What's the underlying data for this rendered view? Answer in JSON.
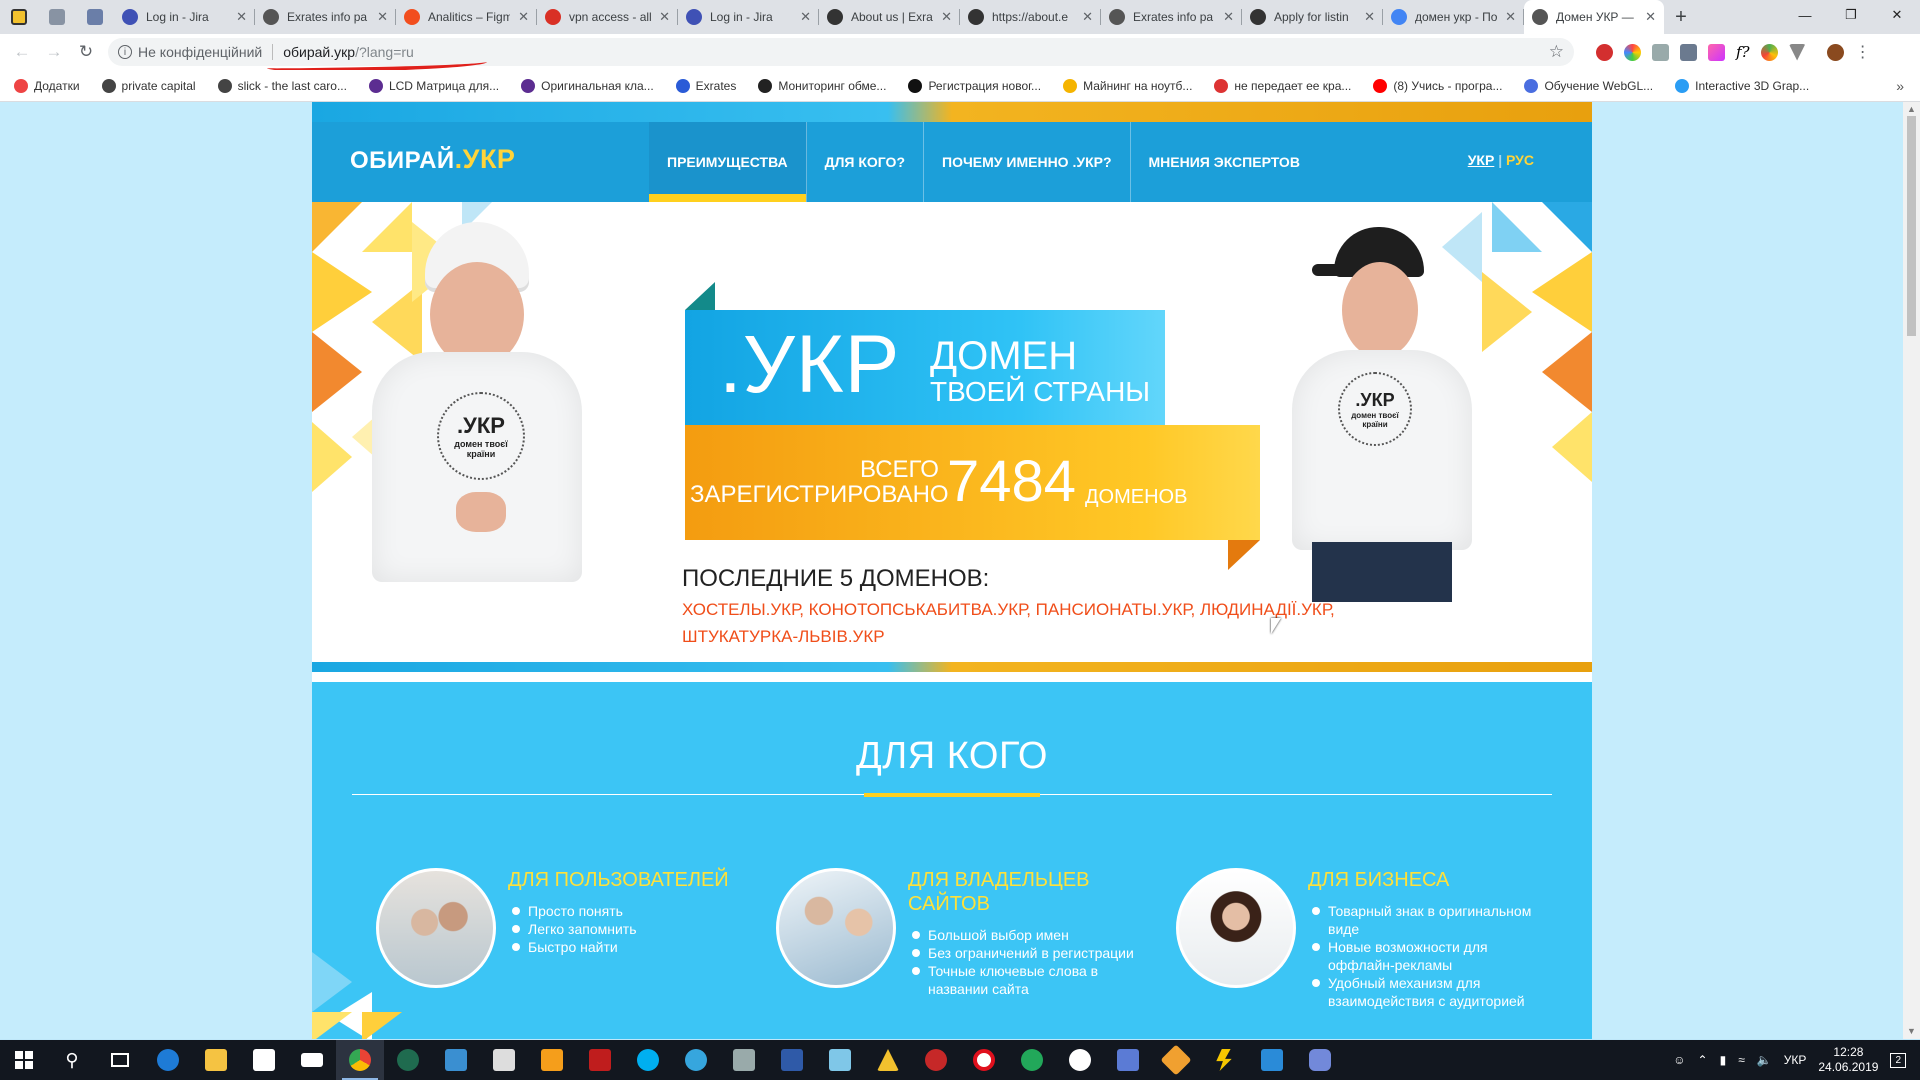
{
  "browser": {
    "tabs": [
      {
        "title": "Log in - Jira",
        "icon": "jira-icon",
        "color": "#3f51b5"
      },
      {
        "title": "Exrates info pa",
        "icon": "globe-icon",
        "color": "#555"
      },
      {
        "title": "Analitics – Figm",
        "icon": "figma-icon",
        "color": "#f24e1e"
      },
      {
        "title": "vpn access - all",
        "icon": "gmail-icon",
        "color": "#d93025"
      },
      {
        "title": "Log in - Jira",
        "icon": "jira-icon",
        "color": "#3f51b5"
      },
      {
        "title": "About us | Exra",
        "icon": "exrates-icon",
        "color": "#333"
      },
      {
        "title": "https://about.e",
        "icon": "exrates-icon",
        "color": "#333"
      },
      {
        "title": "Exrates info pa",
        "icon": "globe-icon",
        "color": "#555"
      },
      {
        "title": "Apply for listin",
        "icon": "exrates-icon",
        "color": "#333"
      },
      {
        "title": "домен укр - По",
        "icon": "google-icon",
        "color": "#4285f4"
      },
      {
        "title": "Домен УКР —",
        "icon": "globe-icon",
        "color": "#555",
        "active": true
      }
    ],
    "address": {
      "security": "Не конфіденційний",
      "url_host": "обирай.укр",
      "url_rest": "/?lang=ru"
    },
    "bookmarks": [
      {
        "label": "Додатки",
        "icon": "apps-icon",
        "color": "#e44"
      },
      {
        "label": "private capital",
        "icon": "globe-icon",
        "color": "#444"
      },
      {
        "label": "slick - the last caro...",
        "icon": "globe-icon",
        "color": "#444"
      },
      {
        "label": "LCD Матрица для...",
        "icon": "store-icon",
        "color": "#5c2d91"
      },
      {
        "label": "Оригинальная кла...",
        "icon": "store-icon",
        "color": "#5c2d91"
      },
      {
        "label": "Exrates",
        "icon": "exrates-icon",
        "color": "#2a5bd7"
      },
      {
        "label": "Мониторинг обме...",
        "icon": "bc-icon",
        "color": "#222"
      },
      {
        "label": "Регистрация новог...",
        "icon": "p-icon",
        "color": "#111"
      },
      {
        "label": "Майнинг на ноутб...",
        "icon": "coin-icon",
        "color": "#f5b400"
      },
      {
        "label": "не передает ее кра...",
        "icon": "chrome-icon",
        "color": "#d33"
      },
      {
        "label": "(8) Учись - програ...",
        "icon": "youtube-icon",
        "color": "#f00"
      },
      {
        "label": "Обучение WebGL...",
        "icon": "translate-icon",
        "color": "#4a6ee0"
      },
      {
        "label": "Interactive 3D Grap...",
        "icon": "u-icon",
        "color": "#2a9df4"
      }
    ]
  },
  "site": {
    "logo_main": "ОБИРАЙ",
    "logo_accent": ".УКР",
    "nav": [
      "ПРЕИМУЩЕСТВА",
      "ДЛЯ КОГО?",
      "ПОЧЕМУ ИМЕННО .УКР?",
      "МНЕНИЯ ЭКСПЕРТОВ"
    ],
    "lang_ukr": "УКР",
    "lang_sep": "|",
    "lang_rus": "РУС",
    "hero": {
      "big": ".УКР",
      "slogan1": "ДОМЕН",
      "slogan2": "ТВОЕЙ СТРАНЫ",
      "reg_line1": "ВСЕГО",
      "reg_line2": "ЗАРЕГИСТРИРОВАНО",
      "count": "7484",
      "count_unit": "ДОМЕНОВ",
      "shirt_text1": ".УКР",
      "shirt_text2": "домен твоєї",
      "shirt_text3": "країни",
      "last_title": "ПОСЛЕДНИЕ 5 ДОМЕНОВ:",
      "last_list": "ХОСТЕЛЫ.УКР, КОНОТОПСЬКАБИТВА.УКР, ПАНСИОНАТЫ.УКР, ЛЮДИНАДІЇ.УКР, ШТУКАТУРКА-ЛЬВІВ.УКР"
    },
    "section2": {
      "title": "ДЛЯ КОГО",
      "columns": [
        {
          "title": "ДЛЯ ПОЛЬЗОВАТЕЛЕЙ",
          "items": [
            "Просто понять",
            "Легко запомнить",
            "Быстро найти"
          ]
        },
        {
          "title": "ДЛЯ ВЛАДЕЛЬЦЕВ САЙТОВ",
          "items": [
            "Большой выбор имен",
            "Без ограничений в регистрации",
            "Точные ключевые слова в названии сайта"
          ]
        },
        {
          "title": "ДЛЯ БИЗНЕСА",
          "items": [
            "Товарный знак в оригинальном виде",
            "Новые возможности для оффлайн-рекламы",
            "Удобный механизм для взаимодействия с аудиторией"
          ]
        }
      ]
    }
  },
  "taskbar": {
    "lang": "УКР",
    "time": "12:28",
    "date": "24.06.2019",
    "notif_count": "2"
  }
}
